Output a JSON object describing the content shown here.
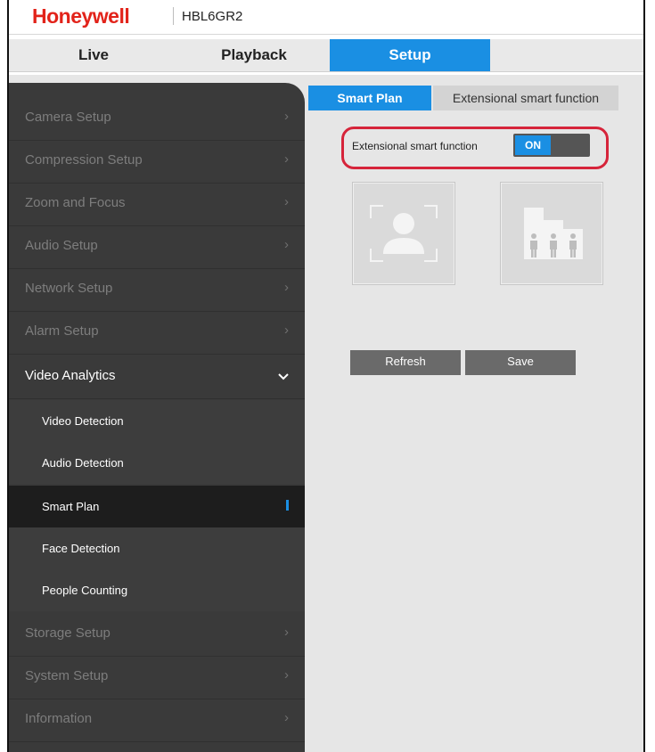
{
  "header": {
    "brand": "Honeywell",
    "model": "HBL6GR2"
  },
  "nav": {
    "live": "Live",
    "playback": "Playback",
    "setup": "Setup",
    "active": "Setup"
  },
  "sidebar": {
    "items": [
      {
        "label": "Camera Setup",
        "icon": "chevron-right-icon"
      },
      {
        "label": "Compression Setup",
        "icon": "chevron-right-icon"
      },
      {
        "label": "Zoom and Focus",
        "icon": "chevron-right-icon"
      },
      {
        "label": "Audio Setup",
        "icon": "chevron-right-icon"
      },
      {
        "label": "Network Setup",
        "icon": "chevron-right-icon"
      },
      {
        "label": "Alarm Setup",
        "icon": "chevron-right-icon"
      },
      {
        "label": "Video Analytics",
        "icon": "chevron-down-icon"
      },
      {
        "label": "Storage Setup",
        "icon": "chevron-right-icon"
      },
      {
        "label": "System Setup",
        "icon": "chevron-right-icon"
      },
      {
        "label": "Information",
        "icon": "chevron-right-icon"
      }
    ],
    "video_analytics_sub": [
      {
        "label": "Video Detection"
      },
      {
        "label": "Audio Detection"
      },
      {
        "label": "Smart Plan"
      },
      {
        "label": "Face Detection"
      },
      {
        "label": "People Counting"
      }
    ],
    "active_sub": "Smart Plan"
  },
  "tabs": {
    "smart_plan": "Smart Plan",
    "extensional": "Extensional smart function"
  },
  "extensional": {
    "label": "Extensional smart function",
    "toggle": "ON"
  },
  "tiles": [
    {
      "icon": "face-detection-icon"
    },
    {
      "icon": "people-counting-icon"
    }
  ],
  "buttons": {
    "refresh": "Refresh",
    "save": "Save"
  },
  "colors": {
    "brand": "#e2231a",
    "accent": "#1a8fe3",
    "sidebar": "#3a3a3a",
    "highlight": "#d6243a"
  }
}
